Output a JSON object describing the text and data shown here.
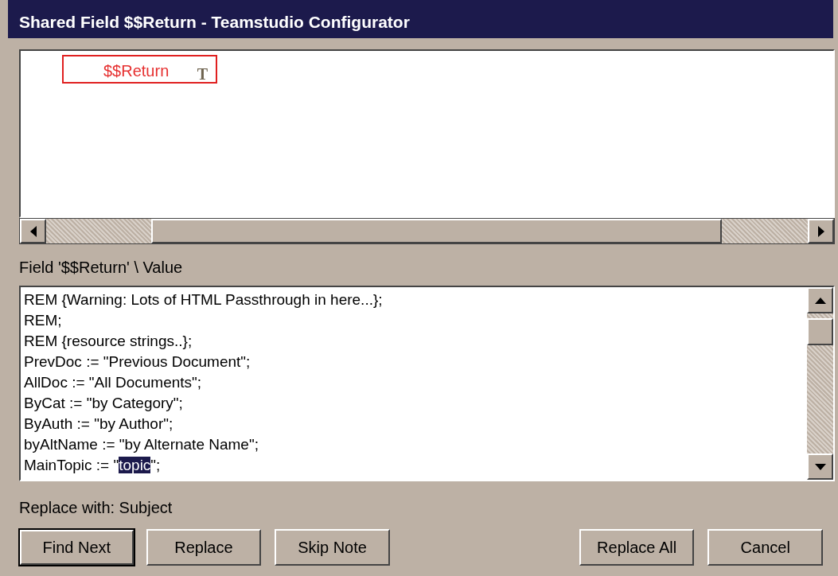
{
  "window": {
    "title": "Shared Field $$Return - Teamstudio Configurator"
  },
  "design_pane": {
    "field_name": "$$Return",
    "type_glyph": "T"
  },
  "value_label": "Field '$$Return' \\ Value",
  "code_lines": [
    [
      {
        "text": "REM {Warning: Lots of HTML Passthrough in here...};",
        "selected": false
      }
    ],
    [
      {
        "text": "REM;",
        "selected": false
      }
    ],
    [
      {
        "text": "REM  {resource strings..};",
        "selected": false
      }
    ],
    [
      {
        "text": "PrevDoc := \"Previous Document\";",
        "selected": false
      }
    ],
    [
      {
        "text": "AllDoc := \"All Documents\";",
        "selected": false
      }
    ],
    [
      {
        "text": "ByCat := \"by Category\";",
        "selected": false
      }
    ],
    [
      {
        "text": "ByAuth := \"by Author\";",
        "selected": false
      }
    ],
    [
      {
        "text": "byAltName := \"by Alternate Name\";",
        "selected": false
      }
    ],
    [
      {
        "text": "MainTopic := \"",
        "selected": false
      },
      {
        "text": "topic",
        "selected": true
      },
      {
        "text": "\";",
        "selected": false
      }
    ]
  ],
  "replace_label": "Replace with: Subject",
  "buttons": [
    {
      "label": "Find Next",
      "default": true
    },
    {
      "label": "Replace",
      "default": false
    },
    {
      "label": "Skip Note",
      "default": false
    },
    {
      "label": "Replace All",
      "default": false
    },
    {
      "label": "Cancel",
      "default": false
    }
  ]
}
